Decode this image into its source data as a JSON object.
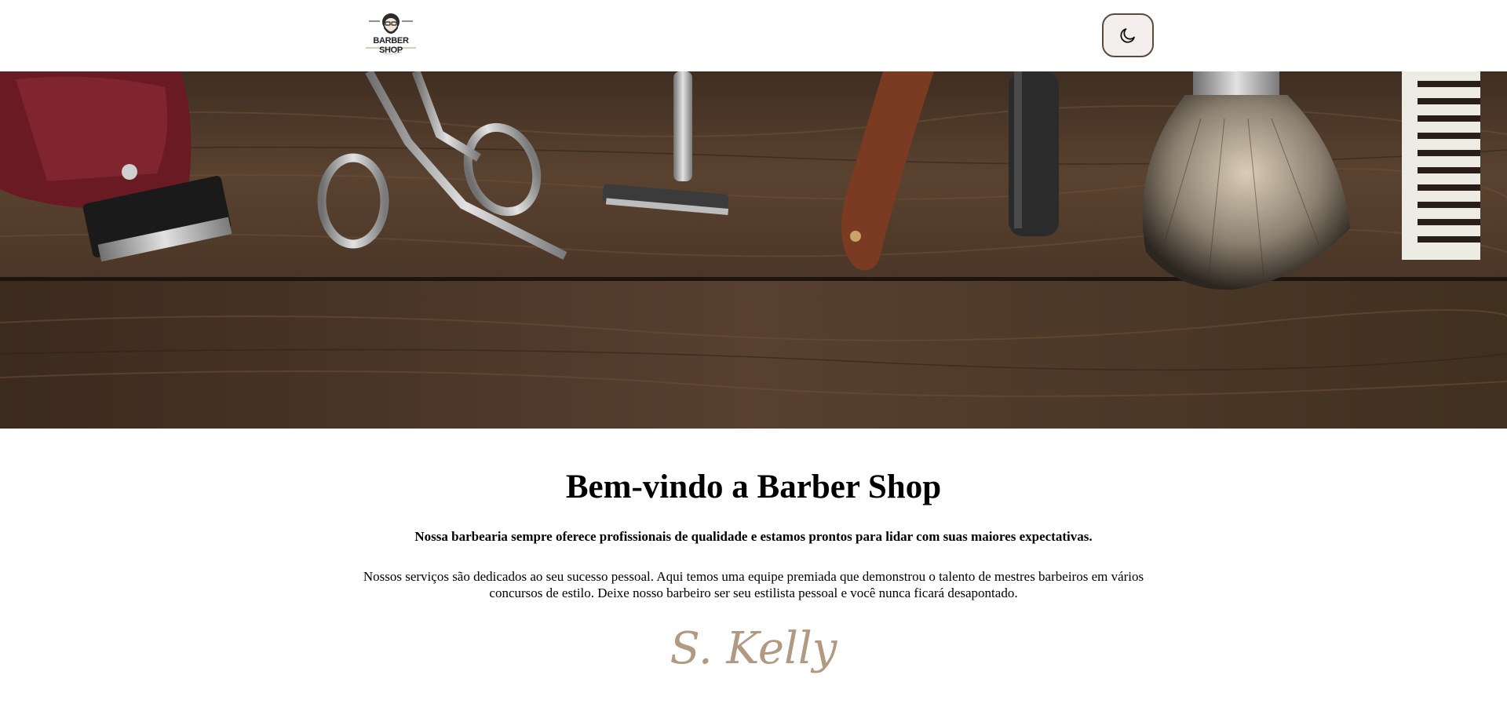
{
  "header": {
    "logo_text": "BARBER SHOP",
    "theme_toggle_icon": "moon-icon"
  },
  "hero": {
    "image": "barber-tools-on-wood-banner",
    "tools": [
      "hair-clipper",
      "scissors",
      "safety-razor",
      "straight-razor",
      "shaving-brush",
      "comb"
    ]
  },
  "content": {
    "title": "Bem-vindo a Barber Shop",
    "lead": "Nossa barbearia sempre oferece profissionais de qualidade e estamos prontos para lidar com suas maiores expectativas.",
    "body": "Nossos serviços são dedicados ao seu sucesso pessoal. Aqui temos uma equipe premiada que demonstrou o talento de mestres barbeiros em vários concursos de estilo. Deixe nosso barbeiro ser seu estilista pessoal e você nunca ficará desapontado.",
    "signature": "S. Kelly"
  },
  "colors": {
    "accent": "#b29a82",
    "toggle_border": "#5b4a3c",
    "toggle_bg": "#f2efec",
    "wood": "#4a3627"
  }
}
